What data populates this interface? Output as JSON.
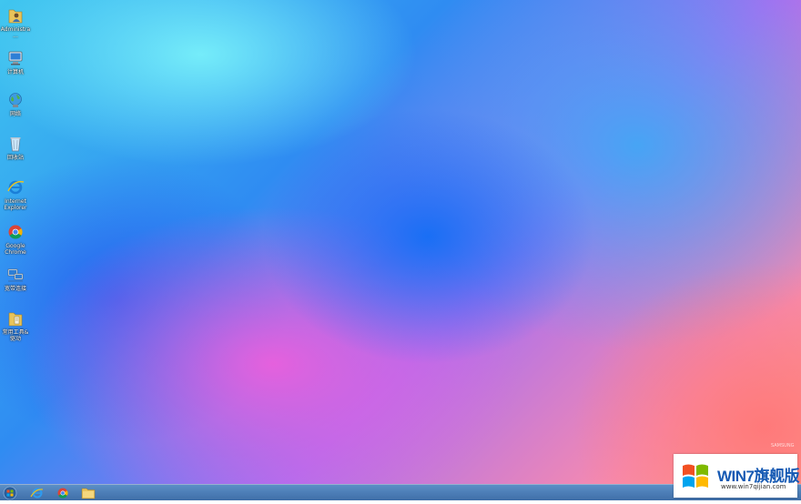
{
  "desktop": {
    "icons": [
      {
        "label": "Administra...",
        "icon": "folder-user-icon"
      },
      {
        "label": "计算机",
        "icon": "computer-icon"
      },
      {
        "label": "网络",
        "icon": "network-globe-icon"
      },
      {
        "label": "回收站",
        "icon": "recycle-bin-icon"
      },
      {
        "label": "Internet Explorer",
        "icon": "internet-explorer-icon"
      },
      {
        "label": "Google Chrome",
        "icon": "chrome-icon"
      },
      {
        "label": "宽带连接",
        "icon": "broadband-connection-icon"
      },
      {
        "label": "常用工具&驱动",
        "icon": "tools-folder-icon"
      }
    ],
    "wallpaper_credit": "SAMSUNG"
  },
  "taskbar": {
    "start": "start-orb-icon",
    "pinned": [
      "internet-explorer-icon",
      "chrome-icon",
      "file-explorer-icon"
    ]
  },
  "watermark": {
    "brand": "WIN7旗舰版",
    "url": "www.win7qijian.com"
  },
  "colors": {
    "taskbar": "#4a7bb5",
    "brand_blue": "#1559b3"
  }
}
